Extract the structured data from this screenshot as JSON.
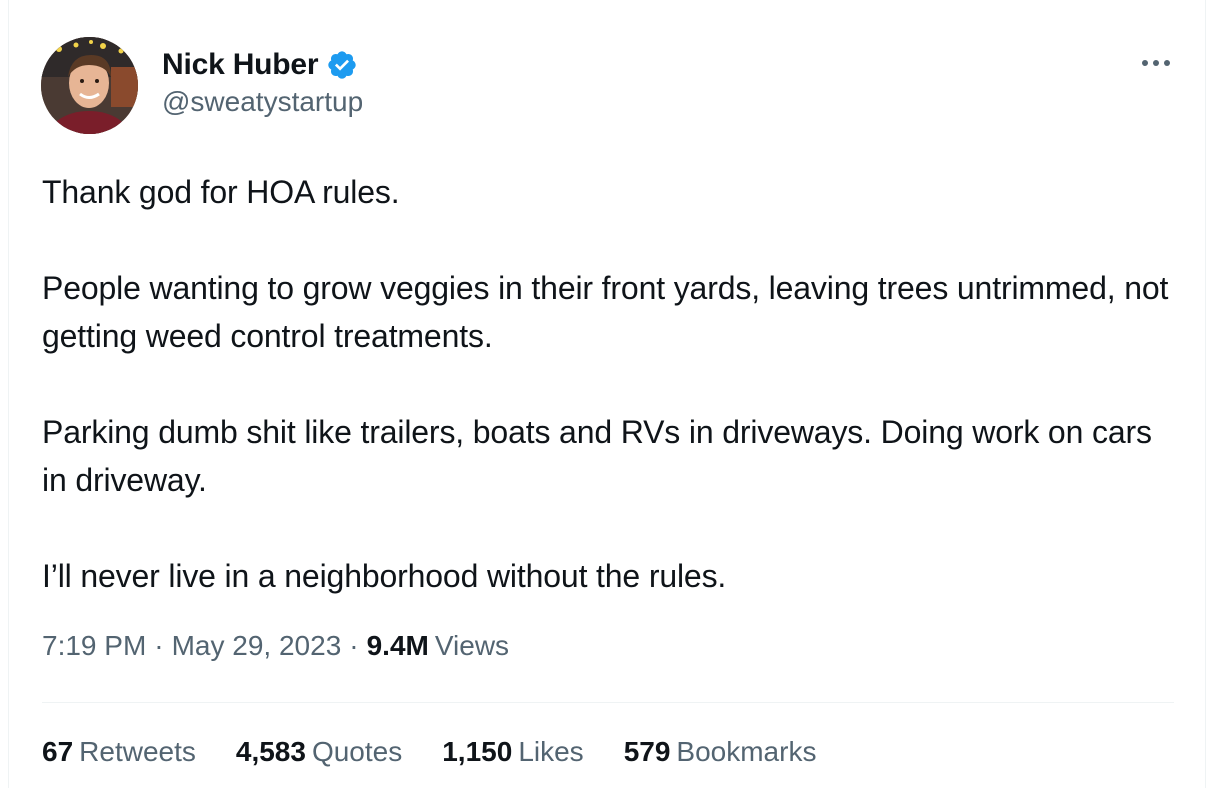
{
  "author": {
    "name": "Nick Huber",
    "handle": "@sweatystartup",
    "verified_color": "#1d9bf0"
  },
  "tweet": {
    "paragraphs": [
      "Thank god for HOA rules.",
      "People wanting to grow veggies in their front yards, leaving trees untrimmed, not getting weed control treatments.",
      "Parking dumb shit like trailers, boats and RVs in driveways. Doing work on cars in driveway.",
      "I’ll never live in a neighborhood without the rules."
    ],
    "time": "7:19 PM",
    "separator": "·",
    "date": "May 29, 2023",
    "views_count": "9.4M",
    "views_label": "Views"
  },
  "stats": [
    {
      "count": "67",
      "label": "Retweets"
    },
    {
      "count": "4,583",
      "label": "Quotes"
    },
    {
      "count": "1,150",
      "label": "Likes"
    },
    {
      "count": "579",
      "label": "Bookmarks"
    }
  ],
  "icons": {
    "more": "more-horizontal-icon",
    "verified": "verified-badge-icon"
  },
  "colors": {
    "text_primary": "#0f1419",
    "text_secondary": "#536471",
    "divider": "#eff3f4",
    "accent": "#1d9bf0"
  }
}
